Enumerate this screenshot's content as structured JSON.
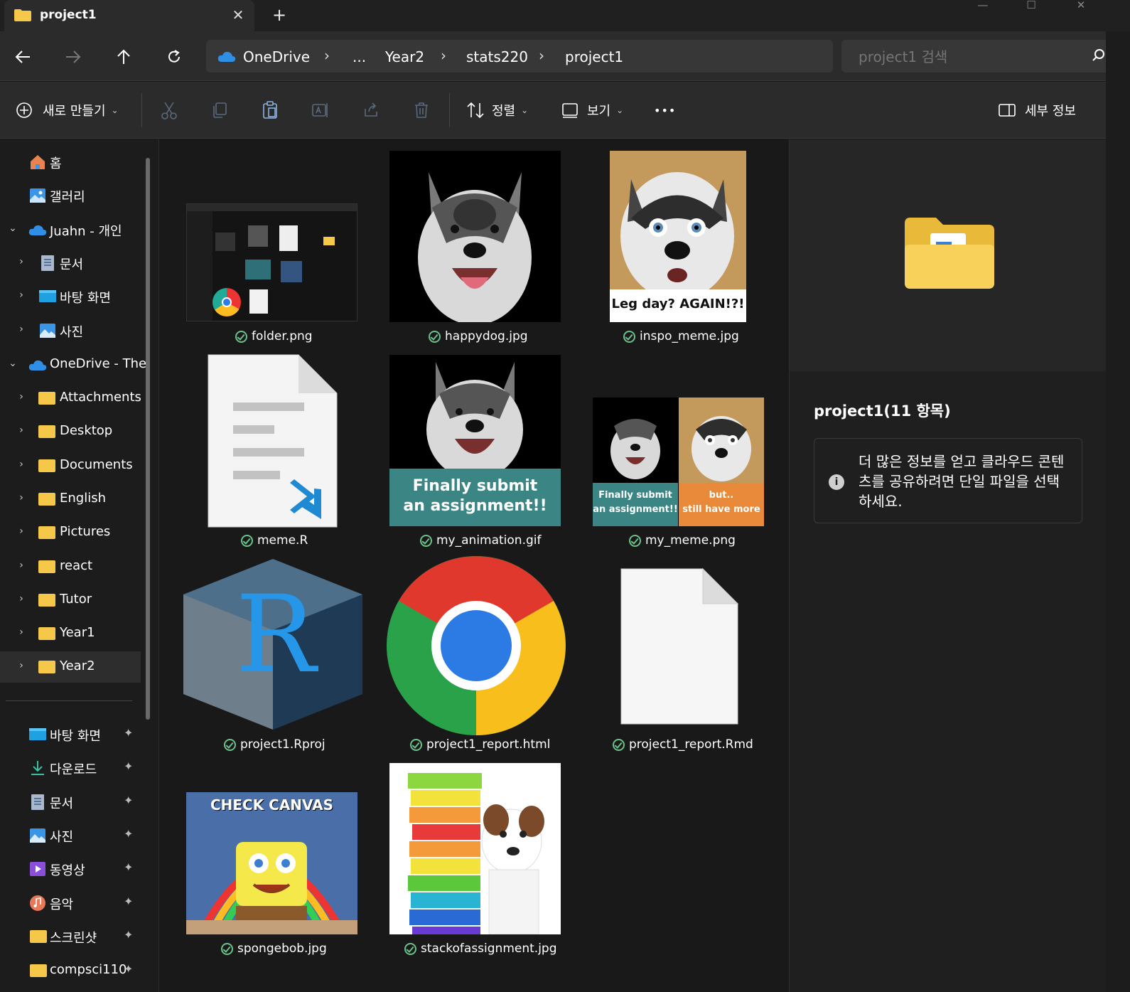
{
  "window": {
    "tab_title": "project1",
    "close_label": "✕",
    "new_tab_label": "+",
    "min_label": "—",
    "max_label": "☐",
    "exit_label": "✕"
  },
  "address": {
    "crumbs": [
      "OneDrive",
      "...",
      "Year2",
      "stats220",
      "project1"
    ],
    "separator": "›",
    "search_placeholder": "project1 검색"
  },
  "toolbar": {
    "new_label": "새로 만들기",
    "sort_label": "정렬",
    "view_label": "보기",
    "more_label": "•••",
    "details_label": "세부 정보"
  },
  "sidebar": {
    "items": [
      {
        "label": "홈",
        "expand": ""
      },
      {
        "label": "갤러리",
        "expand": ""
      },
      {
        "label": "Juahn - 개인",
        "expand": "⌄"
      },
      {
        "label": "문서",
        "expand": "›"
      },
      {
        "label": "바탕 화면",
        "expand": "›"
      },
      {
        "label": "사진",
        "expand": "›"
      },
      {
        "label": "OneDrive - The",
        "expand": "⌄"
      },
      {
        "label": "Attachments",
        "expand": "›"
      },
      {
        "label": "Desktop",
        "expand": "›"
      },
      {
        "label": "Documents",
        "expand": "›"
      },
      {
        "label": "English",
        "expand": "›"
      },
      {
        "label": "Pictures",
        "expand": "›"
      },
      {
        "label": "react",
        "expand": "›"
      },
      {
        "label": "Tutor",
        "expand": "›"
      },
      {
        "label": "Year1",
        "expand": "›"
      },
      {
        "label": "Year2",
        "expand": "›"
      }
    ],
    "quick": [
      {
        "label": "바탕 화면"
      },
      {
        "label": "다운로드"
      },
      {
        "label": "문서"
      },
      {
        "label": "사진"
      },
      {
        "label": "동영상"
      },
      {
        "label": "음악"
      },
      {
        "label": "스크린샷"
      },
      {
        "label": "compsci110"
      }
    ],
    "pin_glyph": "📌"
  },
  "files": [
    {
      "name": "folder.png"
    },
    {
      "name": "happydog.jpg"
    },
    {
      "name": "inspo_meme.jpg"
    },
    {
      "name": "meme.R"
    },
    {
      "name": "my_animation.gif"
    },
    {
      "name": "my_meme.png"
    },
    {
      "name": "project1.Rproj"
    },
    {
      "name": "project1_report.html"
    },
    {
      "name": "project1_report.Rmd"
    },
    {
      "name": "spongebob.jpg"
    },
    {
      "name": "stackofassignment.jpg"
    }
  ],
  "thumb_text": {
    "inspo_caption": "Leg day? AGAIN!?!",
    "anim_caption_1": "Finally submit",
    "anim_caption_2": "an assignment!!",
    "meme_left_1": "Finally submit",
    "meme_left_2": "an assignment!!",
    "meme_right_1": "but..",
    "meme_right_2": "still have more",
    "sponge_caption": "CHECK CANVAS",
    "rproj_letter": "R"
  },
  "details": {
    "title": "project1(11 항목)",
    "info_icon": "i",
    "info_text": "더 많은 정보를 얻고 클라우드 콘텐츠를 공유하려면 단일 파일을 선택하세요."
  }
}
